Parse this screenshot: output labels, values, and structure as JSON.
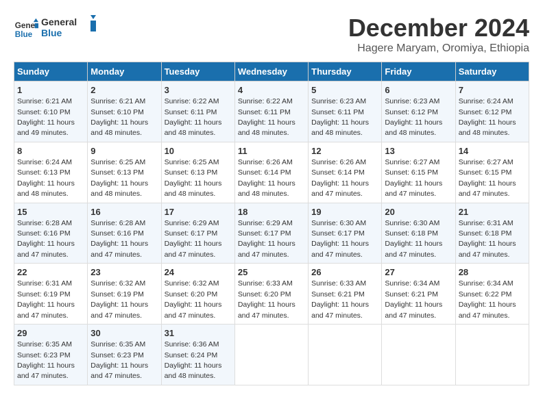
{
  "header": {
    "logo_line1": "General",
    "logo_line2": "Blue",
    "title": "December 2024",
    "subtitle": "Hagere Maryam, Oromiya, Ethiopia"
  },
  "columns": [
    "Sunday",
    "Monday",
    "Tuesday",
    "Wednesday",
    "Thursday",
    "Friday",
    "Saturday"
  ],
  "weeks": [
    [
      {
        "day": "1",
        "info": "Sunrise: 6:21 AM\nSunset: 6:10 PM\nDaylight: 11 hours\nand 49 minutes."
      },
      {
        "day": "2",
        "info": "Sunrise: 6:21 AM\nSunset: 6:10 PM\nDaylight: 11 hours\nand 48 minutes."
      },
      {
        "day": "3",
        "info": "Sunrise: 6:22 AM\nSunset: 6:11 PM\nDaylight: 11 hours\nand 48 minutes."
      },
      {
        "day": "4",
        "info": "Sunrise: 6:22 AM\nSunset: 6:11 PM\nDaylight: 11 hours\nand 48 minutes."
      },
      {
        "day": "5",
        "info": "Sunrise: 6:23 AM\nSunset: 6:11 PM\nDaylight: 11 hours\nand 48 minutes."
      },
      {
        "day": "6",
        "info": "Sunrise: 6:23 AM\nSunset: 6:12 PM\nDaylight: 11 hours\nand 48 minutes."
      },
      {
        "day": "7",
        "info": "Sunrise: 6:24 AM\nSunset: 6:12 PM\nDaylight: 11 hours\nand 48 minutes."
      }
    ],
    [
      {
        "day": "8",
        "info": "Sunrise: 6:24 AM\nSunset: 6:13 PM\nDaylight: 11 hours\nand 48 minutes."
      },
      {
        "day": "9",
        "info": "Sunrise: 6:25 AM\nSunset: 6:13 PM\nDaylight: 11 hours\nand 48 minutes."
      },
      {
        "day": "10",
        "info": "Sunrise: 6:25 AM\nSunset: 6:13 PM\nDaylight: 11 hours\nand 48 minutes."
      },
      {
        "day": "11",
        "info": "Sunrise: 6:26 AM\nSunset: 6:14 PM\nDaylight: 11 hours\nand 48 minutes."
      },
      {
        "day": "12",
        "info": "Sunrise: 6:26 AM\nSunset: 6:14 PM\nDaylight: 11 hours\nand 47 minutes."
      },
      {
        "day": "13",
        "info": "Sunrise: 6:27 AM\nSunset: 6:15 PM\nDaylight: 11 hours\nand 47 minutes."
      },
      {
        "day": "14",
        "info": "Sunrise: 6:27 AM\nSunset: 6:15 PM\nDaylight: 11 hours\nand 47 minutes."
      }
    ],
    [
      {
        "day": "15",
        "info": "Sunrise: 6:28 AM\nSunset: 6:16 PM\nDaylight: 11 hours\nand 47 minutes."
      },
      {
        "day": "16",
        "info": "Sunrise: 6:28 AM\nSunset: 6:16 PM\nDaylight: 11 hours\nand 47 minutes."
      },
      {
        "day": "17",
        "info": "Sunrise: 6:29 AM\nSunset: 6:17 PM\nDaylight: 11 hours\nand 47 minutes."
      },
      {
        "day": "18",
        "info": "Sunrise: 6:29 AM\nSunset: 6:17 PM\nDaylight: 11 hours\nand 47 minutes."
      },
      {
        "day": "19",
        "info": "Sunrise: 6:30 AM\nSunset: 6:17 PM\nDaylight: 11 hours\nand 47 minutes."
      },
      {
        "day": "20",
        "info": "Sunrise: 6:30 AM\nSunset: 6:18 PM\nDaylight: 11 hours\nand 47 minutes."
      },
      {
        "day": "21",
        "info": "Sunrise: 6:31 AM\nSunset: 6:18 PM\nDaylight: 11 hours\nand 47 minutes."
      }
    ],
    [
      {
        "day": "22",
        "info": "Sunrise: 6:31 AM\nSunset: 6:19 PM\nDaylight: 11 hours\nand 47 minutes."
      },
      {
        "day": "23",
        "info": "Sunrise: 6:32 AM\nSunset: 6:19 PM\nDaylight: 11 hours\nand 47 minutes."
      },
      {
        "day": "24",
        "info": "Sunrise: 6:32 AM\nSunset: 6:20 PM\nDaylight: 11 hours\nand 47 minutes."
      },
      {
        "day": "25",
        "info": "Sunrise: 6:33 AM\nSunset: 6:20 PM\nDaylight: 11 hours\nand 47 minutes."
      },
      {
        "day": "26",
        "info": "Sunrise: 6:33 AM\nSunset: 6:21 PM\nDaylight: 11 hours\nand 47 minutes."
      },
      {
        "day": "27",
        "info": "Sunrise: 6:34 AM\nSunset: 6:21 PM\nDaylight: 11 hours\nand 47 minutes."
      },
      {
        "day": "28",
        "info": "Sunrise: 6:34 AM\nSunset: 6:22 PM\nDaylight: 11 hours\nand 47 minutes."
      }
    ],
    [
      {
        "day": "29",
        "info": "Sunrise: 6:35 AM\nSunset: 6:23 PM\nDaylight: 11 hours\nand 47 minutes."
      },
      {
        "day": "30",
        "info": "Sunrise: 6:35 AM\nSunset: 6:23 PM\nDaylight: 11 hours\nand 47 minutes."
      },
      {
        "day": "31",
        "info": "Sunrise: 6:36 AM\nSunset: 6:24 PM\nDaylight: 11 hours\nand 48 minutes."
      },
      {
        "day": "",
        "info": ""
      },
      {
        "day": "",
        "info": ""
      },
      {
        "day": "",
        "info": ""
      },
      {
        "day": "",
        "info": ""
      }
    ]
  ]
}
